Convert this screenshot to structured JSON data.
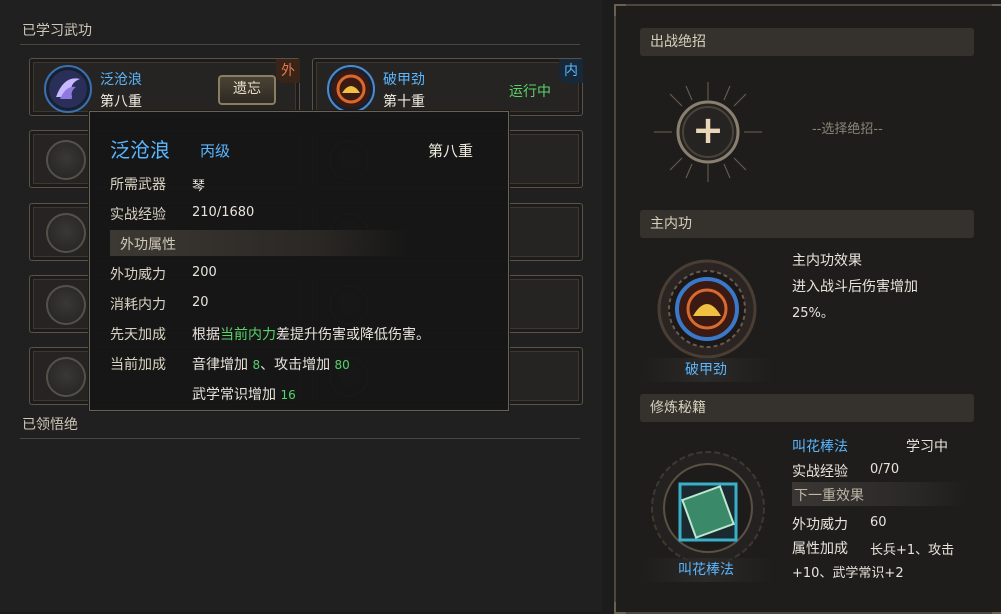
{
  "left": {
    "learned_title": "已学习武功",
    "comprehended_title": "已领悟绝",
    "slots": [
      {
        "name": "泛沧浪",
        "level": "第八重",
        "badge": "外",
        "action": "遗忘"
      },
      {
        "name": "破甲劲",
        "level": "第十重",
        "badge": "内",
        "status": "运行中"
      }
    ]
  },
  "tooltip": {
    "name": "泛沧浪",
    "grade": "丙级",
    "level": "第八重",
    "rows": [
      {
        "label": "所需武器",
        "value": "琴"
      },
      {
        "label": "实战经验",
        "value": "210/1680"
      }
    ],
    "subheader": "外功属性",
    "rows2": [
      {
        "label": "外功威力",
        "value": "200"
      },
      {
        "label": "消耗内力",
        "value": "20"
      }
    ],
    "innate_label": "先天加成",
    "innate_pre": "根据",
    "innate_highlight": "当前内力",
    "innate_post": "差提升伤害或降低伤害。",
    "current_label": "当前加成",
    "current_line1_a": "音律增加",
    "current_line1_a_val": "8",
    "current_line1_sep": "、攻击增加",
    "current_line1_b_val": "80",
    "current_line2_a": "武学常识增加",
    "current_line2_a_val": "16"
  },
  "right": {
    "battle_title": "出战绝招",
    "select_hint": "--选择绝招--",
    "plus": "+",
    "main_title": "主内功",
    "main_effect_title": "主内功效果",
    "main_effect_line1": "进入战斗后伤害增加",
    "main_effect_line2": "25%。",
    "main_skill_name": "破甲劲",
    "book_title": "修炼秘籍",
    "book_name": "叫花棒法",
    "book_status": "学习中",
    "book_exp_label": "实战经验",
    "book_exp_val": "0/70",
    "next_level_header": "下一重效果",
    "power_label": "外功威力",
    "power_val": "60",
    "attr_label": "属性加成",
    "attr_line1": "长兵+1、攻击",
    "attr_line2": "+10、武学常识+2",
    "book_caption": "叫花棒法"
  },
  "colors": {
    "accent_blue": "#5ab6ff",
    "accent_green": "#58d36a",
    "gold": "#d8a040"
  }
}
